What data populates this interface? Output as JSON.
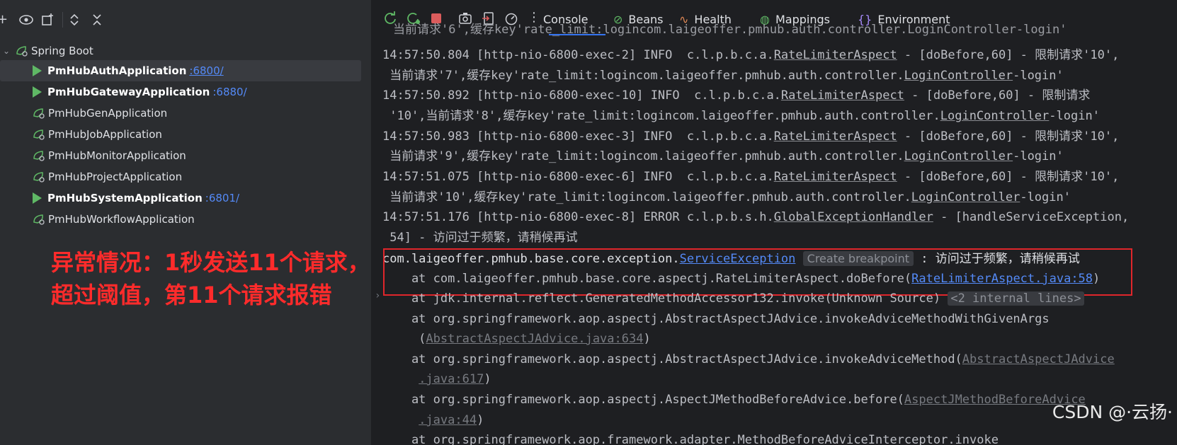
{
  "left_panel": {
    "root_label": "Spring Boot",
    "apps": [
      {
        "name": "PmHubAuthApplication",
        "port": ":6800/",
        "running": true,
        "selected": true
      },
      {
        "name": "PmHubGatewayApplication",
        "port": ":6880/",
        "running": true,
        "selected": false
      },
      {
        "name": "PmHubGenApplication",
        "port": "",
        "running": false,
        "selected": false
      },
      {
        "name": "PmHubJobApplication",
        "port": "",
        "running": false,
        "selected": false
      },
      {
        "name": "PmHubMonitorApplication",
        "port": "",
        "running": false,
        "selected": false
      },
      {
        "name": "PmHubProjectApplication",
        "port": "",
        "running": false,
        "selected": false
      },
      {
        "name": "PmHubSystemApplication",
        "port": ":6801/",
        "running": true,
        "selected": false
      },
      {
        "name": "PmHubWorkflowApplication",
        "port": "",
        "running": false,
        "selected": false
      }
    ],
    "annotation": [
      "异常情况：1秒发送11个请求，",
      "超过阈值，第11个请求报错"
    ]
  },
  "tabs": [
    {
      "label": "Console",
      "icon": "console-tab",
      "active": true
    },
    {
      "label": "Beans",
      "icon": "beans-icon",
      "active": false
    },
    {
      "label": "Health",
      "icon": "health-icon",
      "active": false
    },
    {
      "label": "Mappings",
      "icon": "mappings-icon",
      "active": false
    },
    {
      "label": "Environment",
      "icon": "environment-icon",
      "active": false
    }
  ],
  "console": {
    "l0": "当前请求'6',缓存key'rate_limit:logincom.laigeoffer.pmhub.auth.controller.LoginController-login'",
    "l1a": "14:57:50.804 [http-nio-6800-exec-2] INFO  c.l.p.b.c.a.",
    "l1b": "RateLimiterAspect",
    "l1c": " - [doBefore,60] - 限制请求'10',",
    "l2a": " 当前请求'7',缓存key'rate_limit:logincom.laigeoffer.pmhub.auth.controller.",
    "l2b": "LoginController",
    "l2c": "-login'",
    "l3a": "14:57:50.892 [http-nio-6800-exec-10] INFO  c.l.p.b.c.a.",
    "l3b": "RateLimiterAspect",
    "l3c": " - [doBefore,60] - 限制请求",
    "l4a": " '10',当前请求'8',缓存key'rate_limit:logincom.laigeoffer.pmhub.auth.controller.",
    "l4b": "LoginController",
    "l4c": "-login'",
    "l5a": "14:57:50.983 [http-nio-6800-exec-3] INFO  c.l.p.b.c.a.",
    "l5b": "RateLimiterAspect",
    "l5c": " - [doBefore,60] - 限制请求'10',",
    "l6a": " 当前请求'9',缓存key'rate_limit:logincom.laigeoffer.pmhub.auth.controller.",
    "l6b": "LoginController",
    "l6c": "-login'",
    "l7a": "14:57:51.075 [http-nio-6800-exec-6] INFO  c.l.p.b.c.a.",
    "l7b": "RateLimiterAspect",
    "l7c": " - [doBefore,60] - 限制请求'10',",
    "l8a": " 当前请求'10',缓存key'rate_limit:logincom.laigeoffer.pmhub.auth.controller.",
    "l8b": "LoginController",
    "l8c": "-login'",
    "l9a": "14:57:51.176 [http-nio-6800-exec-8] ERROR c.l.p.b.s.h.",
    "l9b": "GlobalExceptionHandler",
    "l9c": " - [handleServiceException,",
    "l10": " 54] - 访问过于频繁，请稍候再试",
    "l11a": "com.laigeoffer.pmhub.base.core.exception.",
    "l11b": "ServiceException",
    "l11pill": "Create breakpoint",
    "l11c": " : 访问过于频繁，请稍候再试",
    "l12a": "    at com.laigeoffer.pmhub.base.core.aspectj.RateLimiterAspect.doBefore(",
    "l12b": "RateLimiterAspect.java:58",
    "l12c": ")",
    "l13a": "    at jdk.internal.reflect.GeneratedMethodAccessor132.invoke(Unknown Source) ",
    "l13pill": "<2 internal lines>",
    "l14": "    at org.springframework.aop.aspectj.AbstractAspectJAdvice.invokeAdviceMethodWithGivenArgs",
    "l15a": "     (",
    "l15b": "AbstractAspectJAdvice.java:634",
    "l15c": ")",
    "l16a": "    at org.springframework.aop.aspectj.AbstractAspectJAdvice.invokeAdviceMethod(",
    "l16b": "AbstractAspectJAdvice",
    "l17a": "     ",
    "l17b": ".java:617",
    "l17c": ")",
    "l18a": "    at org.springframework.aop.aspectj.AspectJMethodBeforeAdvice.before(",
    "l18b": "AspectJMethodBeforeAdvice",
    "l19a": "     ",
    "l19b": ".java:44",
    "l19c": ")",
    "l20": "    at org.springframework.aop.framework.adapter.MethodBeforeAdviceInterceptor.invoke"
  },
  "watermark": "CSDN @·云扬·",
  "colors": {
    "accent": "#3574f0",
    "link": "#548af7",
    "running": "#5fb865",
    "error_box": "#e0262b",
    "annotation": "#ff2b2b"
  }
}
